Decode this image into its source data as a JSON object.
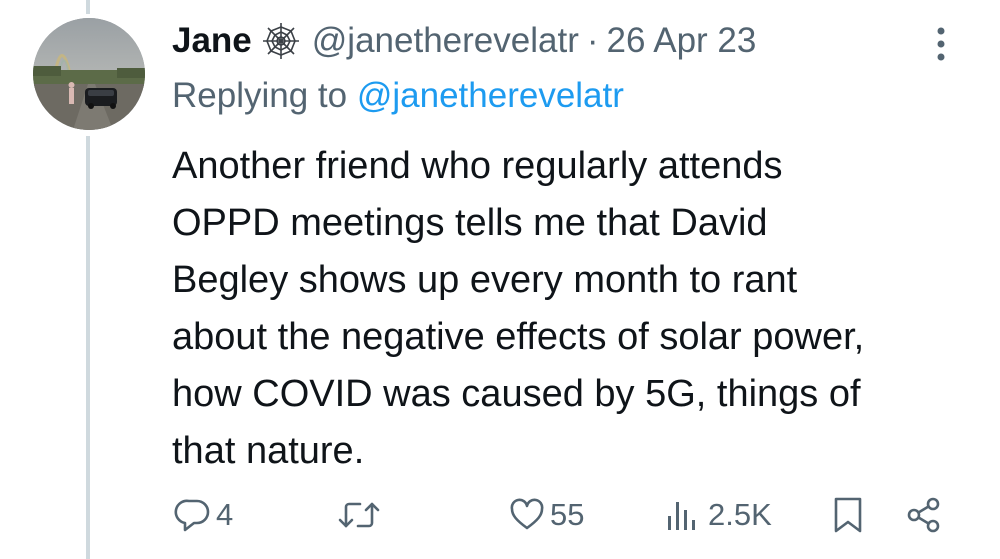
{
  "tweet": {
    "author_name": "Jane",
    "handle": "@janetherevelatr",
    "separator": "·",
    "date": "26 Apr 23",
    "replying_prefix": "Replying to",
    "replying_handle": "@janetherevelatr",
    "body_lines": [
      "Another friend who regularly attends",
      "OPPD meetings tells me that David",
      "Begley shows up every month to rant",
      "about the negative effects of solar power,",
      "how COVID was caused by 5G, things of",
      "that nature."
    ]
  },
  "actions": {
    "reply_count": "4",
    "retweet_count": "",
    "like_count": "55",
    "view_count": "2.5K"
  },
  "icons": {
    "name_badge": "spider-web-icon",
    "more": "more-vertical-icon",
    "reply": "reply-icon",
    "retweet": "retweet-icon",
    "like": "heart-icon",
    "views": "views-icon",
    "bookmark": "bookmark-icon",
    "share": "share-icon"
  },
  "colors": {
    "text": "#0f1419",
    "secondary": "#536471",
    "link": "#1d9bf0",
    "thread_line": "#cfd9de"
  }
}
